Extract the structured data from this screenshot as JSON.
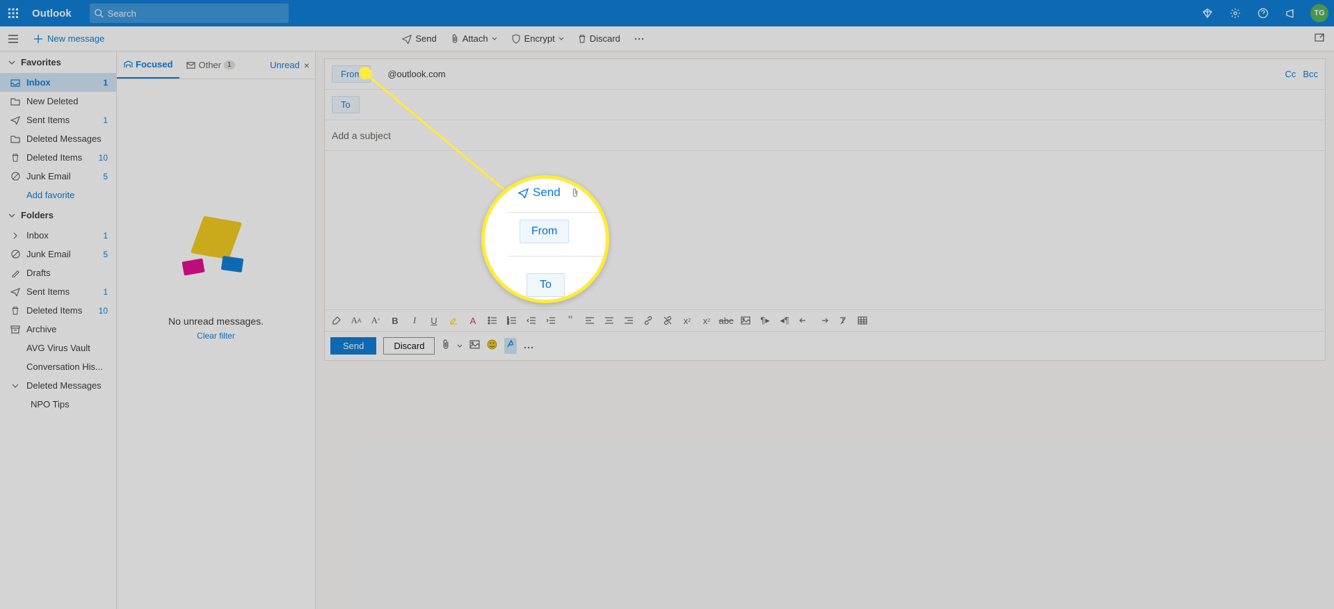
{
  "header": {
    "app_name": "Outlook",
    "search_placeholder": "Search",
    "avatar_initials": "TG"
  },
  "cmdbar": {
    "new_message": "New message",
    "send": "Send",
    "attach": "Attach",
    "encrypt": "Encrypt",
    "discard": "Discard"
  },
  "sidebar": {
    "favorites_label": "Favorites",
    "folders_label": "Folders",
    "add_favorite": "Add favorite",
    "favorites": [
      {
        "icon": "inbox",
        "label": "Inbox",
        "count": "1",
        "selected": true
      },
      {
        "icon": "folder",
        "label": "New Deleted",
        "count": ""
      },
      {
        "icon": "sent",
        "label": "Sent Items",
        "count": "1"
      },
      {
        "icon": "folder",
        "label": "Deleted Messages",
        "count": ""
      },
      {
        "icon": "trash",
        "label": "Deleted Items",
        "count": "10"
      },
      {
        "icon": "block",
        "label": "Junk Email",
        "count": "5"
      }
    ],
    "folders": [
      {
        "icon": "chev",
        "label": "Inbox",
        "count": "1"
      },
      {
        "icon": "block",
        "label": "Junk Email",
        "count": "5"
      },
      {
        "icon": "draft",
        "label": "Drafts",
        "count": ""
      },
      {
        "icon": "sent",
        "label": "Sent Items",
        "count": "1"
      },
      {
        "icon": "trash",
        "label": "Deleted Items",
        "count": "10"
      },
      {
        "icon": "archive",
        "label": "Archive",
        "count": ""
      },
      {
        "icon": "",
        "label": "AVG Virus Vault",
        "count": ""
      },
      {
        "icon": "",
        "label": "Conversation His...",
        "count": ""
      },
      {
        "icon": "chevd",
        "label": "Deleted Messages",
        "count": ""
      }
    ],
    "subfolder": "NPO Tips"
  },
  "msglist": {
    "focused": "Focused",
    "other": "Other",
    "other_badge": "1",
    "filter": "Unread",
    "empty_text": "No unread messages.",
    "clear_filter": "Clear filter"
  },
  "compose": {
    "from_label": "From",
    "from_email": "@outlook.com",
    "to_label": "To",
    "cc": "Cc",
    "bcc": "Bcc",
    "subject_placeholder": "Add a subject",
    "send": "Send",
    "discard": "Discard"
  },
  "magnifier": {
    "send": "Send",
    "from": "From",
    "to": "To"
  }
}
